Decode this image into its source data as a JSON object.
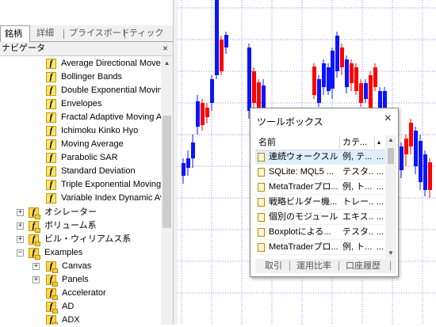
{
  "navigator": {
    "tabs": [
      "銘柄",
      "詳細",
      "プライスボード",
      "ティック"
    ],
    "active_tab": "銘柄",
    "panel_title": "ナビゲータ",
    "close_symbol": "×",
    "items": [
      {
        "label": "Average Directional Movement"
      },
      {
        "label": "Bollinger Bands"
      },
      {
        "label": "Double Exponential Moving Average"
      },
      {
        "label": "Envelopes"
      },
      {
        "label": "Fractal Adaptive Moving Average"
      },
      {
        "label": "Ichimoku Kinko Hyo"
      },
      {
        "label": "Moving Average"
      },
      {
        "label": "Parabolic SAR"
      },
      {
        "label": "Standard Deviation"
      },
      {
        "label": "Triple Exponential Moving Average"
      },
      {
        "label": "Variable Index Dynamic Average"
      }
    ],
    "folders": [
      {
        "label": "オシレーター",
        "expander": "+"
      },
      {
        "label": "ボリューム系",
        "expander": "+"
      },
      {
        "label": "ビル・ウィリアムス系",
        "expander": "+"
      },
      {
        "label": "Examples",
        "expander": "−"
      }
    ],
    "example_folders": [
      {
        "label": "Canvas",
        "expander": "+"
      },
      {
        "label": "Panels",
        "expander": "+"
      }
    ],
    "examples": [
      {
        "label": "Accelerator"
      },
      {
        "label": "AD"
      },
      {
        "label": "ADX"
      }
    ]
  },
  "colors": {
    "bull": "#0a14ff",
    "bear": "#ff0000",
    "grid": "#8c8cff"
  },
  "toolbox": {
    "title": "ツールボックス",
    "close_symbol": "×",
    "columns": [
      "名前",
      "カテ...",
      "▴"
    ],
    "rows": [
      {
        "name": "連続ウォークスル...",
        "cat": "例, テ...",
        "more": "..."
      },
      {
        "name": "SQLite: MQL5 ...",
        "cat": "テスタ...",
        "more": "..."
      },
      {
        "name": "MetaTraderプロ...",
        "cat": "例, ト...",
        "more": "..."
      },
      {
        "name": "戦略ビルダー機...",
        "cat": "トレー...",
        "more": "..."
      },
      {
        "name": "個別のモジュール...",
        "cat": "エキス...",
        "more": "..."
      },
      {
        "name": "Boxplotによる...",
        "cat": "テスタ...",
        "more": "..."
      },
      {
        "name": "MetaTraderプロ...",
        "cat": "例, ト...",
        "more": "..."
      }
    ],
    "bottom_tabs": [
      "取引",
      "運用比率",
      "口座履歴"
    ]
  }
}
